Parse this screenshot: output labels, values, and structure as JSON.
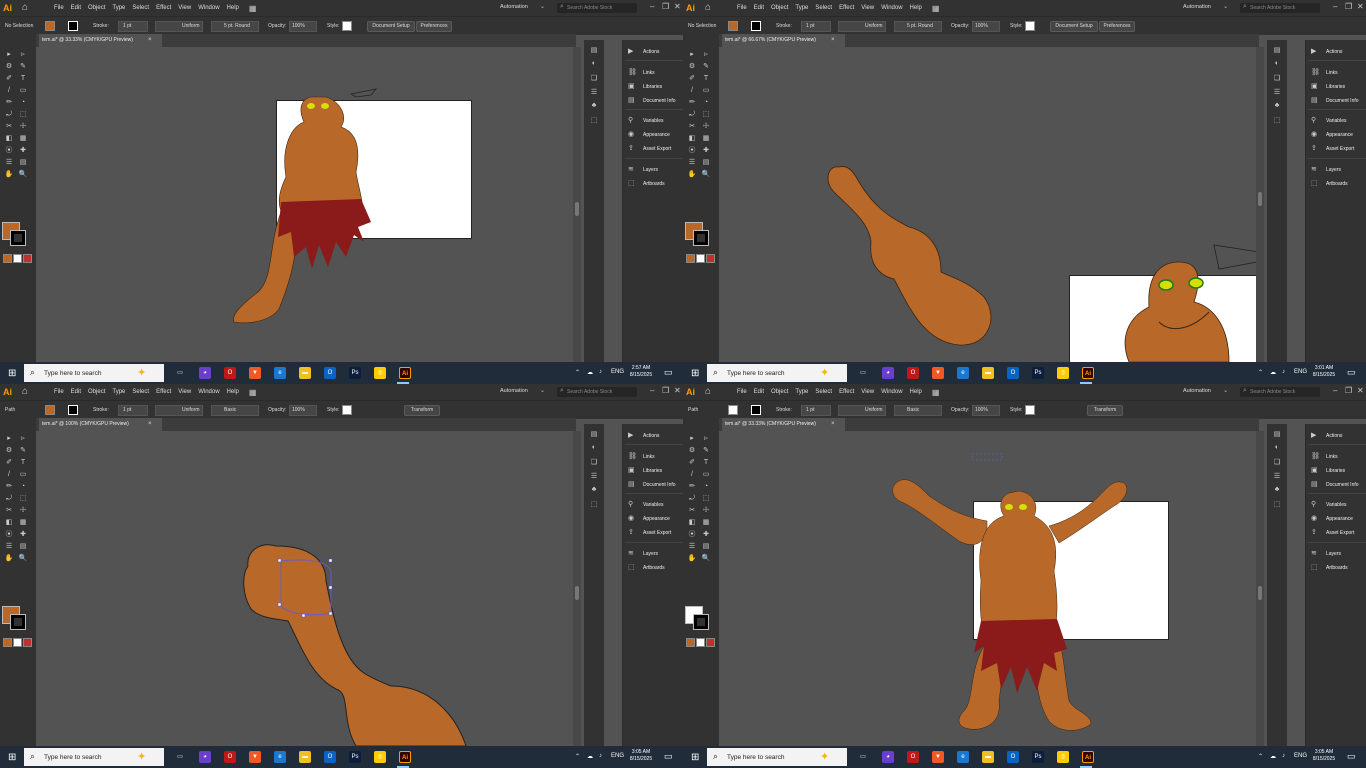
{
  "app": {
    "logo": "Ai",
    "menus": [
      "File",
      "Edit",
      "Object",
      "Type",
      "Select",
      "Effect",
      "View",
      "Window",
      "Help"
    ],
    "automation": "Automation",
    "search_placeholder": "Search Adobe Stock",
    "search_placeholder_alt": "Search Adobe Stock"
  },
  "control_bar": {
    "no_selection": "No Selection",
    "path": "Path",
    "stroke": "Stroke:",
    "stroke_weight": "1 pt",
    "uniform": "Uniform",
    "brush": "5 pt. Round",
    "basic": "Basic",
    "opacity": "Opacity:",
    "opacity_value": "100%",
    "style": "Style:",
    "document_setup": "Document Setup",
    "preferences": "Preferences",
    "transform": "Transform"
  },
  "panels": {
    "items": [
      {
        "icon": "play-icon",
        "label": "Actions"
      },
      {
        "icon": "links-icon",
        "label": "Links"
      },
      {
        "icon": "libraries-icon",
        "label": "Libraries"
      },
      {
        "icon": "document-info-icon",
        "label": "Document Info"
      },
      {
        "icon": "variables-icon",
        "label": "Variables"
      },
      {
        "icon": "appearance-icon",
        "label": "Appearance"
      },
      {
        "icon": "asset-export-icon",
        "label": "Asset Export"
      },
      {
        "icon": "layers-icon",
        "label": "Layers"
      },
      {
        "icon": "artboards-icon",
        "label": "Artboards"
      }
    ]
  },
  "taskbar": {
    "search_placeholder": "Type here to search",
    "lang": "ENG",
    "apps": [
      "task-view",
      "copilot",
      "opera",
      "brave",
      "edge",
      "file-explorer",
      "outlook",
      "photoshop",
      "chrome",
      "illustrator"
    ]
  },
  "windows": [
    {
      "tab": "tem.ai* @ 33.33% (CMYK/GPU Preview)",
      "time": "2:57 AM",
      "date": "8/15/2025",
      "mode": "no_selection"
    },
    {
      "tab": "tem.ai* @ 66.67% (CMYK/GPU Preview)",
      "time": "3:01 AM",
      "date": "8/15/2025",
      "mode": "no_selection"
    },
    {
      "tab": "tem.ai* @ 100% (CMYK/GPU Preview)",
      "time": "3:05 AM",
      "date": "8/15/2025",
      "mode": "path"
    },
    {
      "tab": "tem.ai* @ 33.33% (CMYK/GPU Preview)",
      "time": "3:05 AM",
      "date": "8/15/2025",
      "mode": "path"
    }
  ],
  "colors": {
    "fill": "#b8692a",
    "skin_stroke": "#3a2410",
    "loincloth": "#8b1a1a",
    "eyes": "#d6e000",
    "ui_dark": "#323232",
    "canvas": "#535353",
    "taskbar": "#202c3a"
  }
}
